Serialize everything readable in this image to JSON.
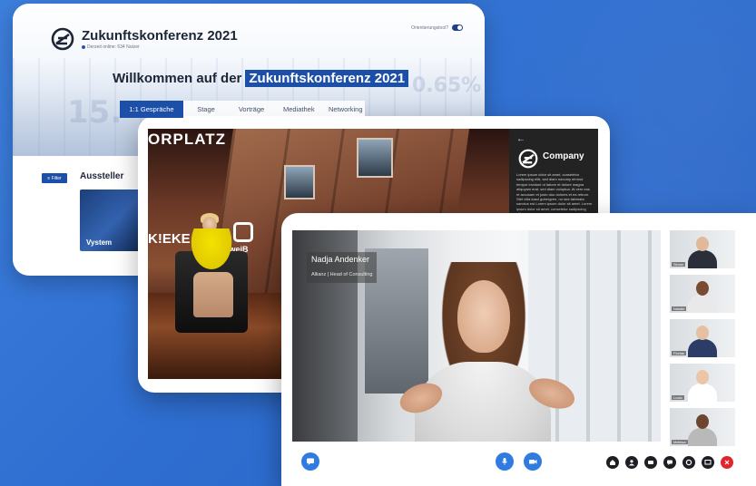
{
  "conference": {
    "title": "Zukunftskonferenz 2021",
    "online_text": "Derzeit online: 634 Nutzer",
    "orientation_label": "Orientierungstool?",
    "welcome_prefix": "Willkommen auf der",
    "welcome_highlight": "Zukunftskonferenz 2021",
    "tabs": [
      {
        "label": "1:1 Gespräche",
        "active": true
      },
      {
        "label": "Stage",
        "active": false
      },
      {
        "label": "Vorträge",
        "active": false
      },
      {
        "label": "Mediathek",
        "active": false
      },
      {
        "label": "Networking",
        "active": false
      }
    ],
    "filter_label": "≡ Filter",
    "exhibitors_heading": "Aussteller",
    "exhibitor_card": "Vystem",
    "background_numbers": [
      "15.",
      "0.65%"
    ]
  },
  "stage": {
    "title_fragment": "ORPLATZ",
    "sign_left": "K!EKE",
    "sign_right": "zweiB",
    "panel": {
      "back_icon": "arrow-left-icon",
      "company_name": "Company",
      "lorem": "Lorem ipsum dolor sit amet, consetetur sadipscing elitr, sed diam nonumy eirmod tempor invidunt ut labore et dolore magna aliquyam erat, sed diam voluptua. At vero eos et accusam et justo duo dolores et ea rebum. Stet clita kasd gubergren, no sea takimata sanctus est Lorem ipsum dolor sit amet. Lorem ipsum dolor sit amet, consetetur sadipscing elitr."
    }
  },
  "videocall": {
    "speaker_name": "Nadja Andenker",
    "speaker_role": "Allianz  |  Head of Consulting",
    "thumbnails": [
      {
        "label": "Simon",
        "skin": "#e0b89a",
        "shirt": "#2a2f3a"
      },
      {
        "label": "Natalie",
        "skin": "#7a4b33",
        "shirt": "#e9e9e9"
      },
      {
        "label": "Florian",
        "skin": "#e5c0a2",
        "shirt": "#2b3d66"
      },
      {
        "label": "Lucia",
        "skin": "#ecc5a8",
        "shirt": "#ffffff"
      },
      {
        "label": "Melissa",
        "skin": "#6e4630",
        "shirt": "#b9b9b9"
      }
    ],
    "toolbar": {
      "left": "chat-icon",
      "center": [
        "microphone-icon",
        "camera-icon"
      ],
      "right": [
        "home-icon",
        "user-icon",
        "group-icon",
        "message-icon",
        "settings-icon",
        "screen-share-icon",
        "close-icon"
      ]
    },
    "colors": {
      "accent": "#2f7be0",
      "danger": "#e0262d"
    }
  }
}
